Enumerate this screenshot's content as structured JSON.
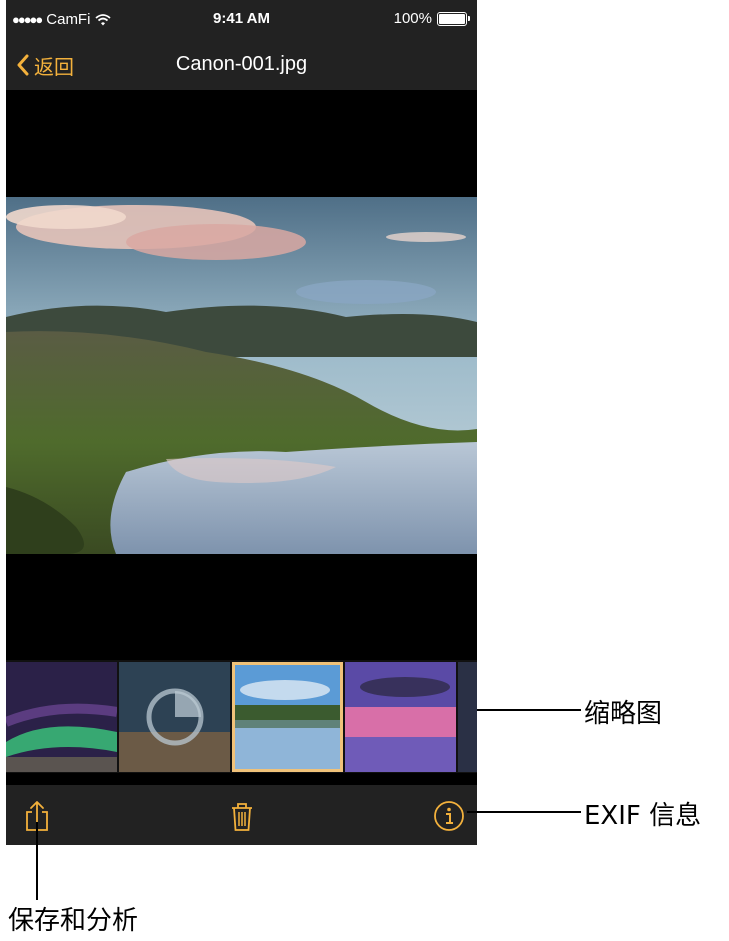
{
  "status_bar": {
    "carrier": "CamFi",
    "time": "9:41 AM",
    "battery": "100%"
  },
  "nav": {
    "back_label": "返回",
    "title": "Canon-001.jpg"
  },
  "toolbar": {
    "share_icon": "share-icon",
    "delete_icon": "trash-icon",
    "info_icon": "info-icon"
  },
  "thumbnails": {
    "selected_index": 2,
    "loading_index": 1
  },
  "callouts": {
    "thumbnails": "缩略图",
    "exif": "EXIF 信息",
    "save": "保存和分析"
  },
  "colors": {
    "accent": "#f3b13c",
    "bar_background": "#222222",
    "selected_border": "#f0c27a"
  }
}
